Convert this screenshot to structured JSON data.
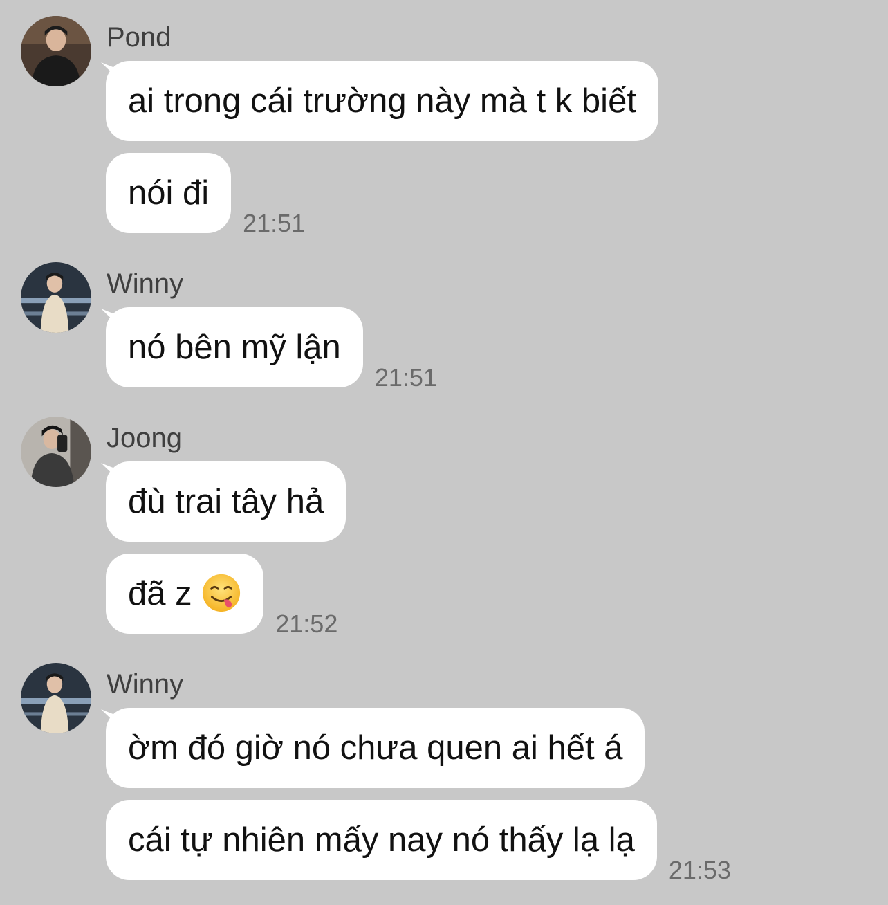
{
  "messages": [
    {
      "sender": "Pond",
      "avatar_icon": "user-photo-avatar",
      "bubbles": [
        "ai trong cái trường này mà t k biết",
        "nói đi"
      ],
      "time": "21:51"
    },
    {
      "sender": "Winny",
      "avatar_icon": "user-photo-avatar",
      "bubbles": [
        "nó bên mỹ lận"
      ],
      "time": "21:51"
    },
    {
      "sender": "Joong",
      "avatar_icon": "user-photo-avatar",
      "bubbles": [
        "đù trai tây hả",
        "đã z"
      ],
      "emoji": "face-savoring-food-emoji",
      "time": "21:52"
    },
    {
      "sender": "Winny",
      "avatar_icon": "user-photo-avatar",
      "bubbles": [
        "ờm đó giờ nó chưa quen ai hết á",
        "cái tự nhiên mấy nay nó thấy lạ lạ"
      ],
      "time": "21:53"
    }
  ],
  "colors": {
    "background": "#c8c8c8",
    "bubble": "#ffffff",
    "sender_name": "#3f3f3f",
    "timestamp": "#6a6a6a"
  }
}
